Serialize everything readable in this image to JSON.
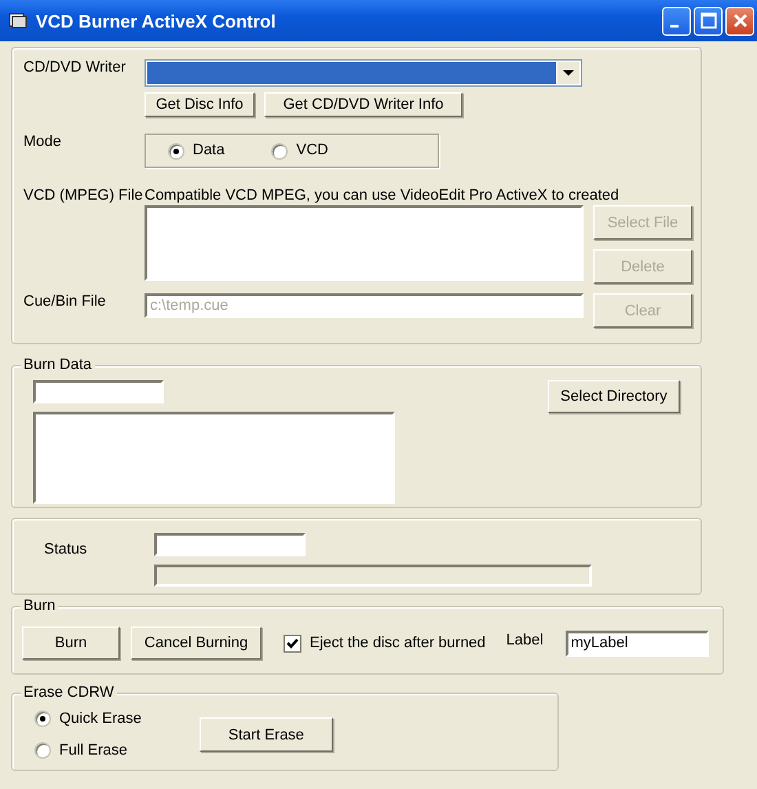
{
  "window": {
    "title": "VCD Burner ActiveX Control"
  },
  "writer": {
    "label": "CD/DVD Writer",
    "dropdown": {
      "highlighted": true
    },
    "buttons": [
      "Get Disc Info",
      "Get CD/DVD Writer Info"
    ]
  },
  "mode": {
    "label": "Mode",
    "options": [
      {
        "label": "Data",
        "selected": true
      },
      {
        "label": "VCD",
        "selected": false
      }
    ]
  },
  "vcd_file": {
    "label": "VCD (MPEG) File",
    "hint": "Compatible VCD MPEG, you can use VideoEdit Pro ActiveX to created",
    "buttons": [
      {
        "label": "Select File",
        "disabled": true
      },
      {
        "label": "Delete",
        "disabled": true
      }
    ]
  },
  "cue_bin": {
    "label": "Cue/Bin File",
    "value": "c:\\temp.cue",
    "disabled": true,
    "button": {
      "label": "Clear",
      "disabled": true
    }
  },
  "burn_data": {
    "title": "Burn Data",
    "button": "Select Directory"
  },
  "status": {
    "label": "Status",
    "progress": {
      "level": 0
    }
  },
  "burn": {
    "title": "Burn",
    "buttons": [
      "Burn",
      "Cancel Burning"
    ],
    "eject": {
      "label": "Eject the disc after burned",
      "checked": true
    },
    "label_field": {
      "label": "Label",
      "value": "myLabel"
    }
  },
  "erase": {
    "title": "Erase CDRW",
    "options": [
      {
        "label": "Quick Erase",
        "selected": true
      },
      {
        "label": "Full Erase",
        "selected": false
      }
    ],
    "button": "Start Erase"
  }
}
